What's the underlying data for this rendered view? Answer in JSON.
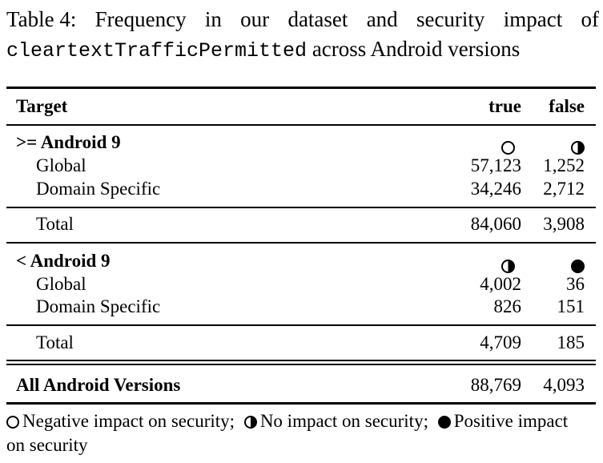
{
  "caption": {
    "prefix": "Table 4:",
    "line1_words": [
      "Frequency",
      "in",
      "our",
      "dataset",
      "and",
      "security",
      "impact",
      "of"
    ],
    "code_term": "cleartextTrafficPermitted",
    "line2_rest": "across Android versions"
  },
  "table": {
    "headers": {
      "target": "Target",
      "true": "true",
      "false": "false"
    },
    "groups": [
      {
        "name": ">= Android 9",
        "true_symbol": "empty-circle-icon",
        "false_symbol": "half-circle-icon",
        "rows": [
          {
            "label": "Global",
            "true": "57,123",
            "false": "1,252"
          },
          {
            "label": "Domain Specific",
            "true": "34,246",
            "false": "2,712"
          }
        ],
        "total": {
          "label": "Total",
          "true": "84,060",
          "false": "3,908"
        }
      },
      {
        "name": "< Android 9",
        "true_symbol": "half-circle-icon",
        "false_symbol": "filled-circle-icon",
        "rows": [
          {
            "label": "Global",
            "true": "4,002",
            "false": "36"
          },
          {
            "label": "Domain Specific",
            "true": "826",
            "false": "151"
          }
        ],
        "total": {
          "label": "Total",
          "true": "4,709",
          "false": "185"
        }
      }
    ],
    "overall": {
      "label": "All Android Versions",
      "true": "88,769",
      "false": "4,093"
    }
  },
  "legend": {
    "negative": "Negative impact on security;",
    "neutral": "No impact on security;",
    "positive_line1": "Positive impact",
    "positive_line2": "on security"
  }
}
